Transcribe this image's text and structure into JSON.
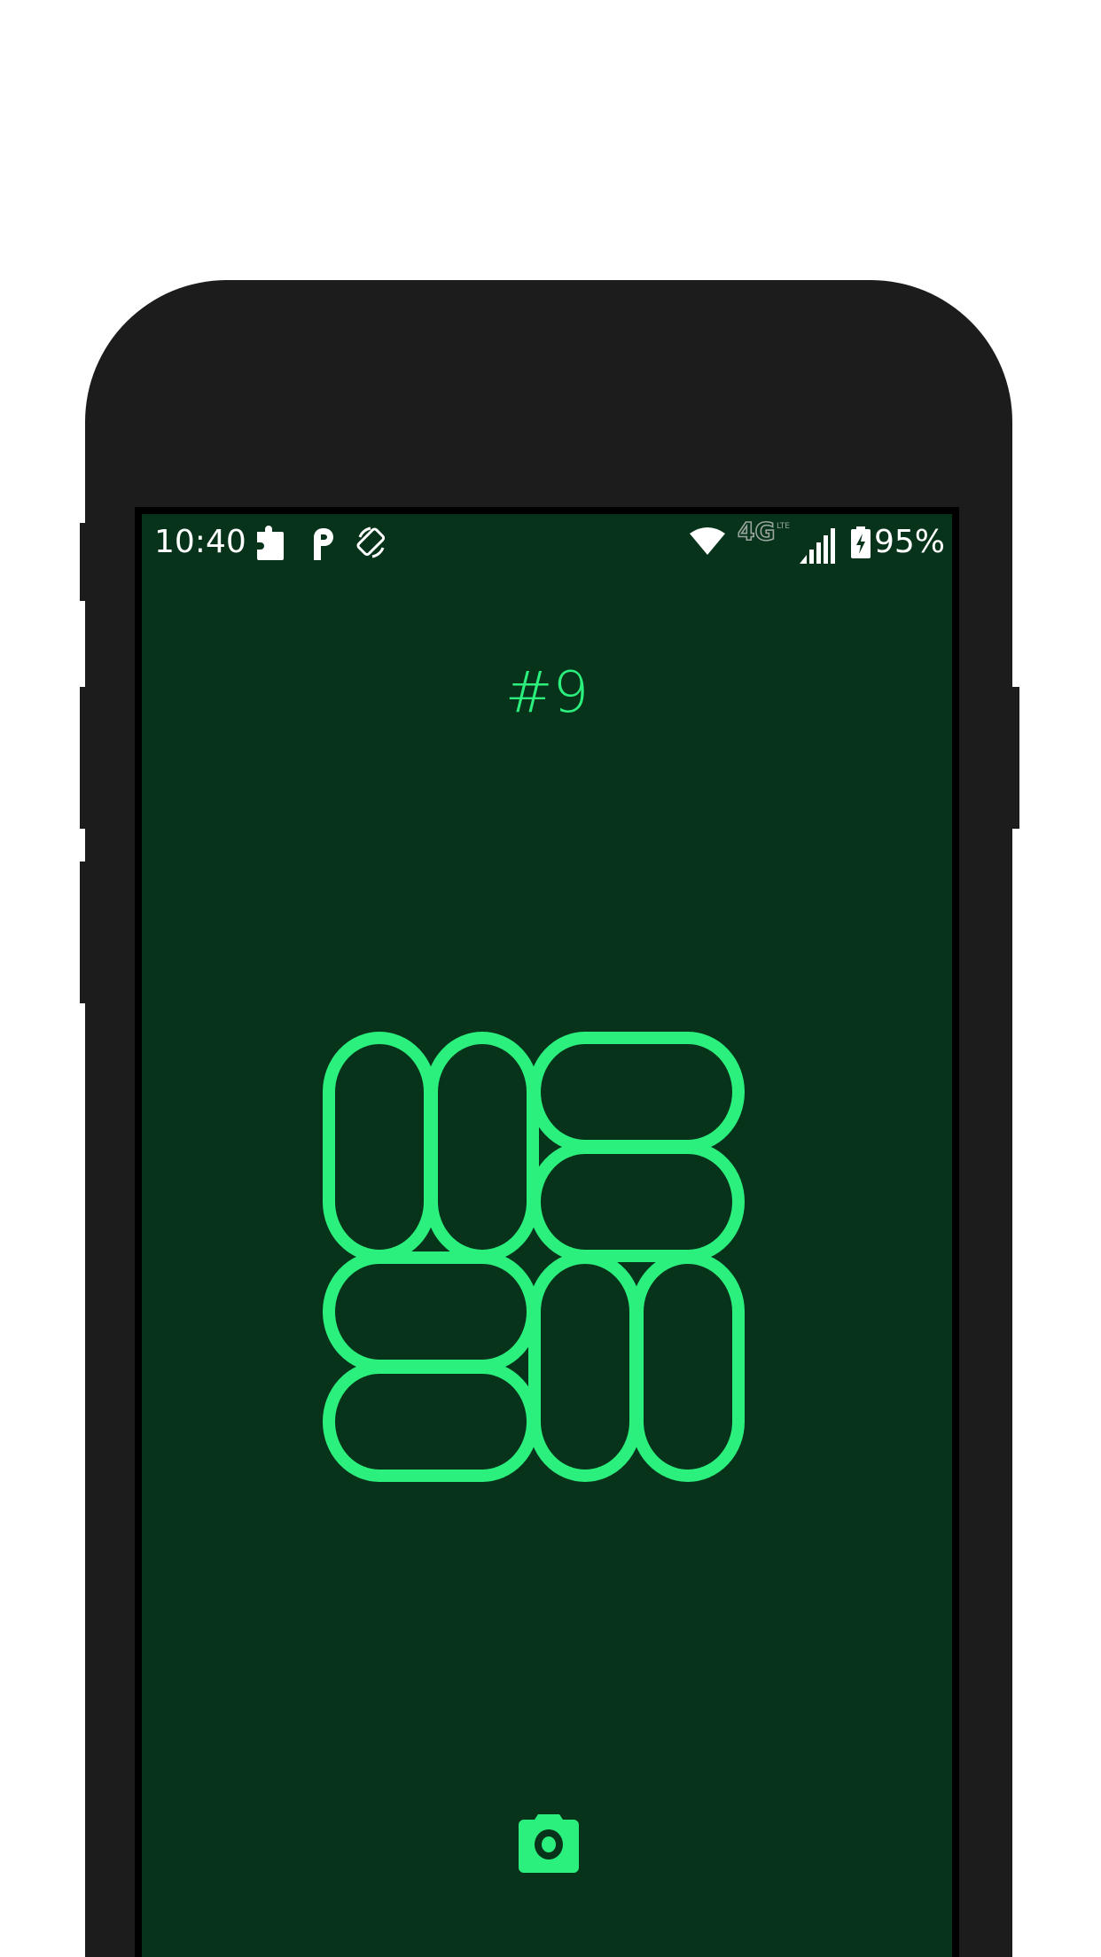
{
  "status_bar": {
    "time": "10:40",
    "battery_percent": "95%",
    "network_type": "4G",
    "network_sub": "LTE",
    "left_icons": [
      "puzzle-icon",
      "parking-icon",
      "screen-rotation-icon"
    ],
    "right_icons": [
      "wifi-icon",
      "network-type-icon",
      "signal-icon",
      "battery-charging-icon"
    ]
  },
  "level": {
    "title": "#9",
    "grid_size": {
      "rows": 4,
      "cols": 4
    },
    "pieces": [
      {
        "name": "piece-vertical-col1-rows1-2",
        "orientation": "vertical",
        "col": 1,
        "row": 1,
        "span": 2
      },
      {
        "name": "piece-vertical-col2-rows1-2",
        "orientation": "vertical",
        "col": 2,
        "row": 1,
        "span": 2
      },
      {
        "name": "piece-horizontal-row1-cols3-4",
        "orientation": "horizontal",
        "col": 3,
        "row": 1,
        "span": 2
      },
      {
        "name": "piece-horizontal-row2-cols3-4",
        "orientation": "horizontal",
        "col": 3,
        "row": 2,
        "span": 2
      },
      {
        "name": "piece-horizontal-row3-cols1-2",
        "orientation": "horizontal",
        "col": 1,
        "row": 3,
        "span": 2
      },
      {
        "name": "piece-vertical-col3-rows3-4",
        "orientation": "vertical",
        "col": 3,
        "row": 3,
        "span": 2
      },
      {
        "name": "piece-vertical-col4-rows3-4",
        "orientation": "vertical",
        "col": 4,
        "row": 3,
        "span": 2
      },
      {
        "name": "piece-horizontal-row4-cols1-2",
        "orientation": "horizontal",
        "col": 1,
        "row": 4,
        "span": 2
      }
    ]
  },
  "actions": {
    "camera_icon": "camera-icon"
  },
  "colors": {
    "accent": "#2cf07e",
    "screen_background": "#063319",
    "phone_body": "#1c1c1c",
    "status_text": "#ffffff"
  }
}
